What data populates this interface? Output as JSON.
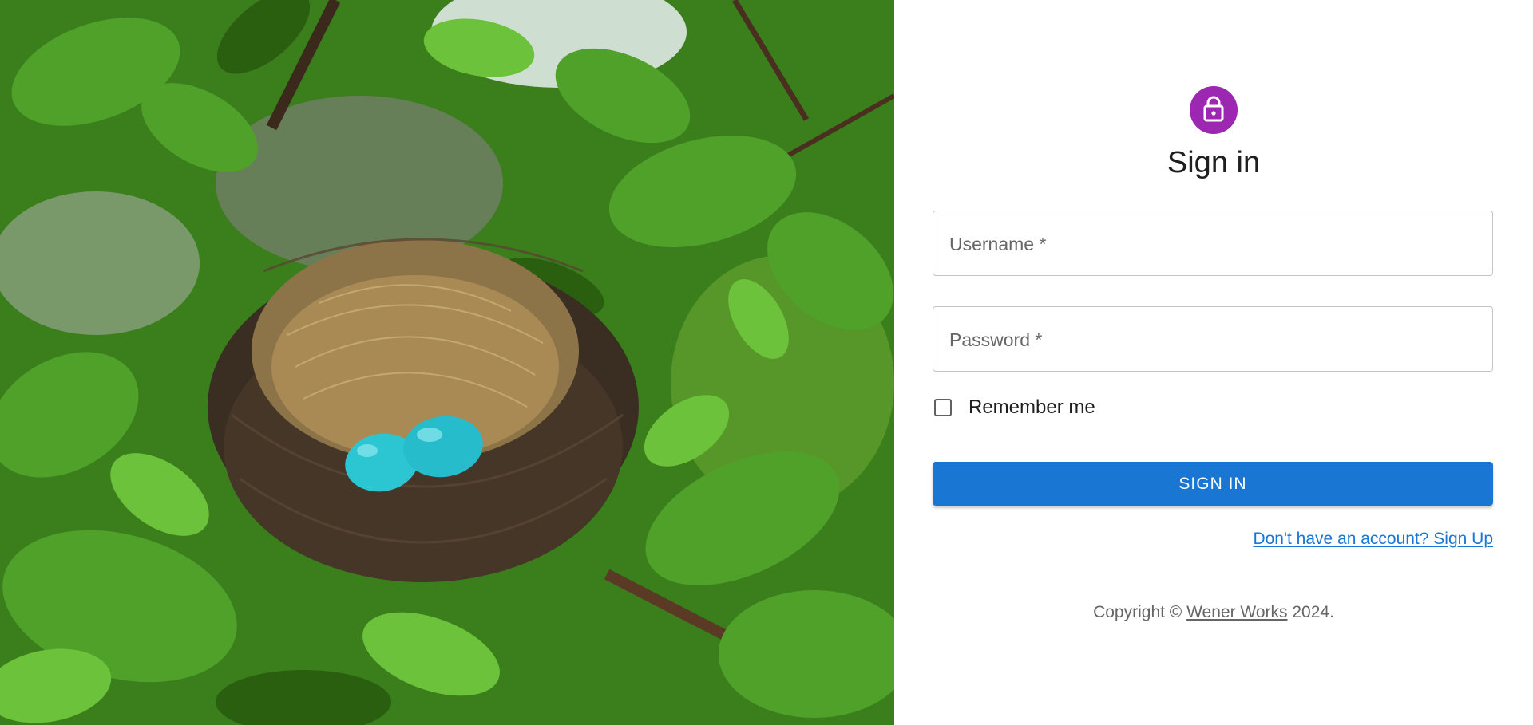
{
  "hero": {
    "image": "bird-nest-with-blue-eggs-in-green-leaves"
  },
  "form": {
    "icon": "lock-icon",
    "title": "Sign in",
    "username_label": "Username *",
    "password_label": "Password *",
    "remember_label": "Remember me",
    "remember_checked": false,
    "submit_label": "Sign In",
    "signup_link": "Don't have an account? Sign Up"
  },
  "footer": {
    "prefix": "Copyright © ",
    "company": "Wener Works",
    "suffix": " 2024."
  },
  "colors": {
    "avatar": "#9c27b0",
    "primary": "#1976d2",
    "egg": "#2cc6d3"
  }
}
